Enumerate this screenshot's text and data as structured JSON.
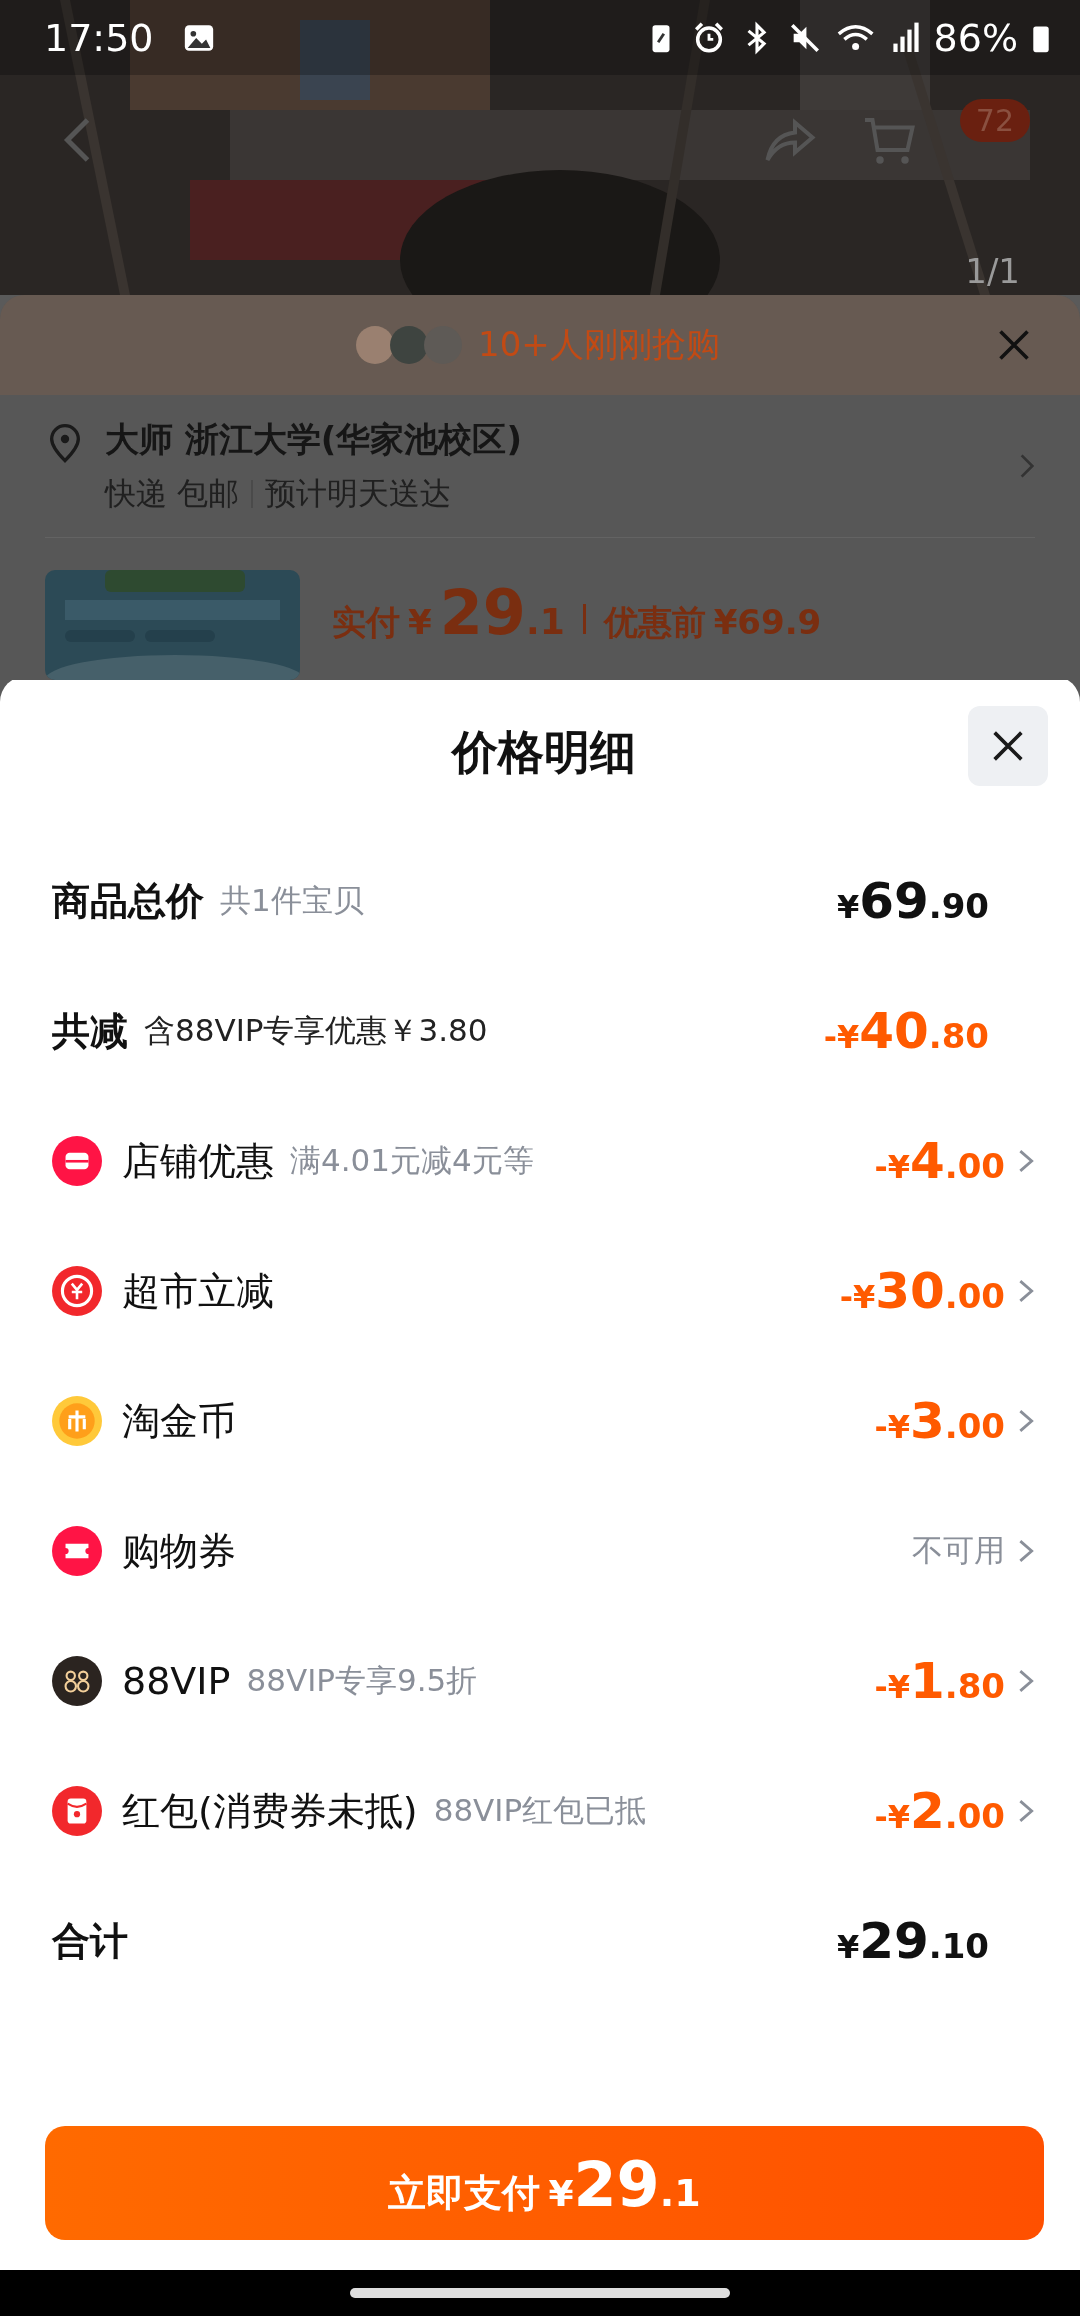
{
  "status_bar": {
    "time": "17:50",
    "battery": "86%"
  },
  "nav": {
    "cart_badge": "72",
    "image_counter": "1/1"
  },
  "purchase_sheet": {
    "buyers_text": "10+人刚刚抢购",
    "address": "大师 浙江大学(华家池校区)",
    "shipping": "快递 包邮",
    "delivery": "预计明天送达",
    "paid_label": "实付",
    "paid_currency": "¥",
    "paid_integer": "29",
    "paid_decimal": ".1",
    "original_label": "优惠前",
    "original_price": "¥69.9"
  },
  "price_detail": {
    "title": "价格明细",
    "total": {
      "label": "商品总价",
      "note": "共1件宝贝",
      "currency": "¥",
      "integer": "69",
      "decimal": ".90"
    },
    "reduction": {
      "label": "共减",
      "note": "含88VIP专享优惠￥3.80",
      "sign": "-¥",
      "integer": "40",
      "decimal": ".80"
    },
    "items": [
      {
        "kind": "amount",
        "label": "店铺优惠",
        "note": "满4.01元减4元等",
        "sign": "-¥",
        "integer": "4",
        "decimal": ".00"
      },
      {
        "kind": "amount",
        "label": "超市立减",
        "sign": "-¥",
        "integer": "30",
        "decimal": ".00"
      },
      {
        "kind": "amount",
        "label": "淘金币",
        "sign": "-¥",
        "integer": "3",
        "decimal": ".00"
      },
      {
        "kind": "unavailable",
        "label": "购物券",
        "status": "不可用"
      },
      {
        "kind": "amount",
        "label": "88VIP",
        "note": "88VIP专享9.5折",
        "sign": "-¥",
        "integer": "1",
        "decimal": ".80"
      },
      {
        "kind": "amount",
        "label": "红包(消费券未抵)",
        "note": "88VIP红包已抵",
        "sign": "-¥",
        "integer": "2",
        "decimal": ".00"
      }
    ],
    "sum": {
      "label": "合计",
      "currency": "¥",
      "integer": "29",
      "decimal": ".10"
    }
  },
  "pay_button": {
    "label": "立即支付",
    "currency": "¥",
    "integer": "29",
    "decimal": ".1"
  }
}
